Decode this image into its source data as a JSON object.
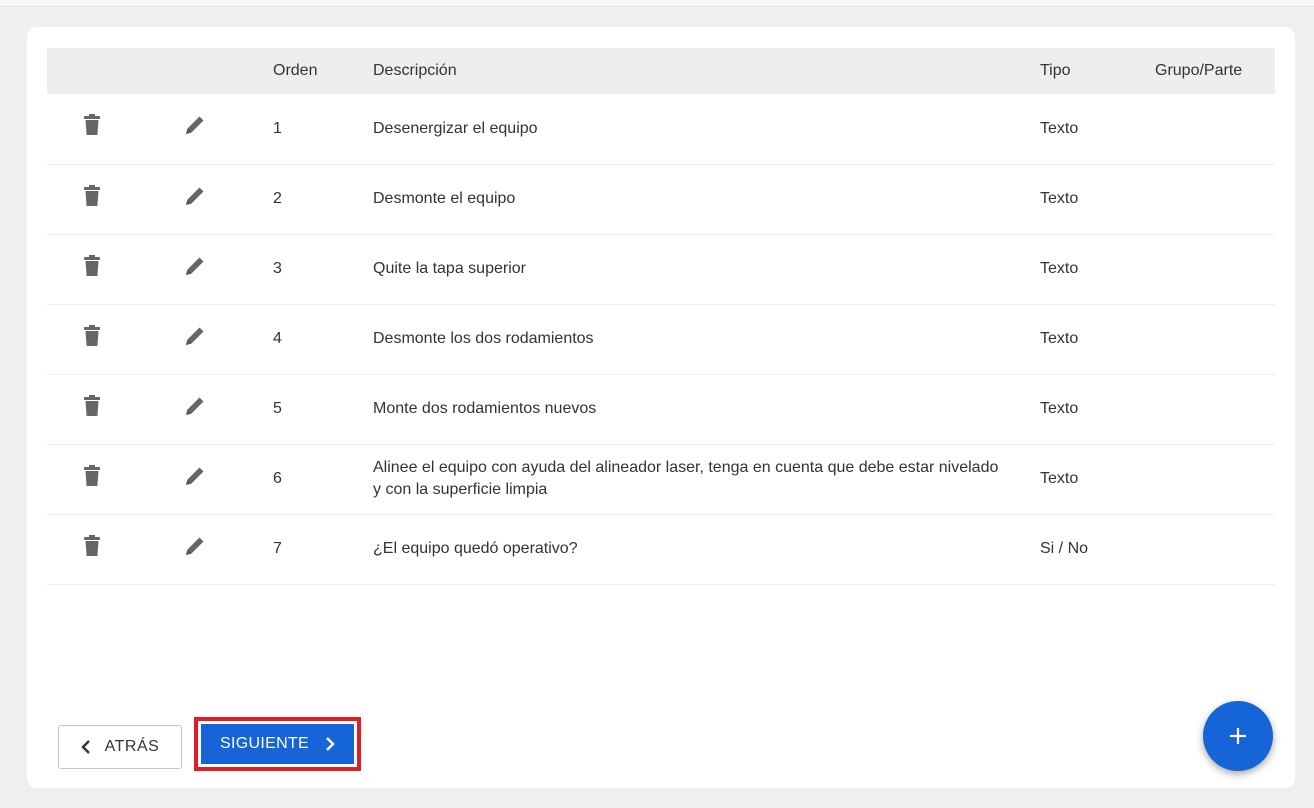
{
  "table": {
    "headers": [
      "",
      "",
      "Orden",
      "Descripción",
      "Tipo",
      "Grupo/Parte"
    ],
    "rows": [
      {
        "order": "1",
        "description": "Desenergizar el equipo",
        "type": "Texto",
        "group": ""
      },
      {
        "order": "2",
        "description": "Desmonte el equipo",
        "type": "Texto",
        "group": ""
      },
      {
        "order": "3",
        "description": "Quite la tapa superior",
        "type": "Texto",
        "group": ""
      },
      {
        "order": "4",
        "description": "Desmonte los dos rodamientos",
        "type": "Texto",
        "group": ""
      },
      {
        "order": "5",
        "description": "Monte dos rodamientos nuevos",
        "type": "Texto",
        "group": ""
      },
      {
        "order": "6",
        "description": "Alinee el equipo con ayuda del alineador laser, tenga en cuenta que debe estar nivelado y con la superficie limpia",
        "type": "Texto",
        "group": ""
      },
      {
        "order": "7",
        "description": "¿El equipo quedó operativo?",
        "type": "Si / No",
        "group": ""
      }
    ],
    "row_icons": [
      "trash-icon",
      "pencil-icon"
    ]
  },
  "footer": {
    "back_label": "ATRÁS",
    "next_label": "SIGUIENTE",
    "add_icon": "plus-icon"
  },
  "colors": {
    "accent": "#1565d8",
    "highlight": "#e11d2a",
    "icon_gray": "#666666"
  }
}
